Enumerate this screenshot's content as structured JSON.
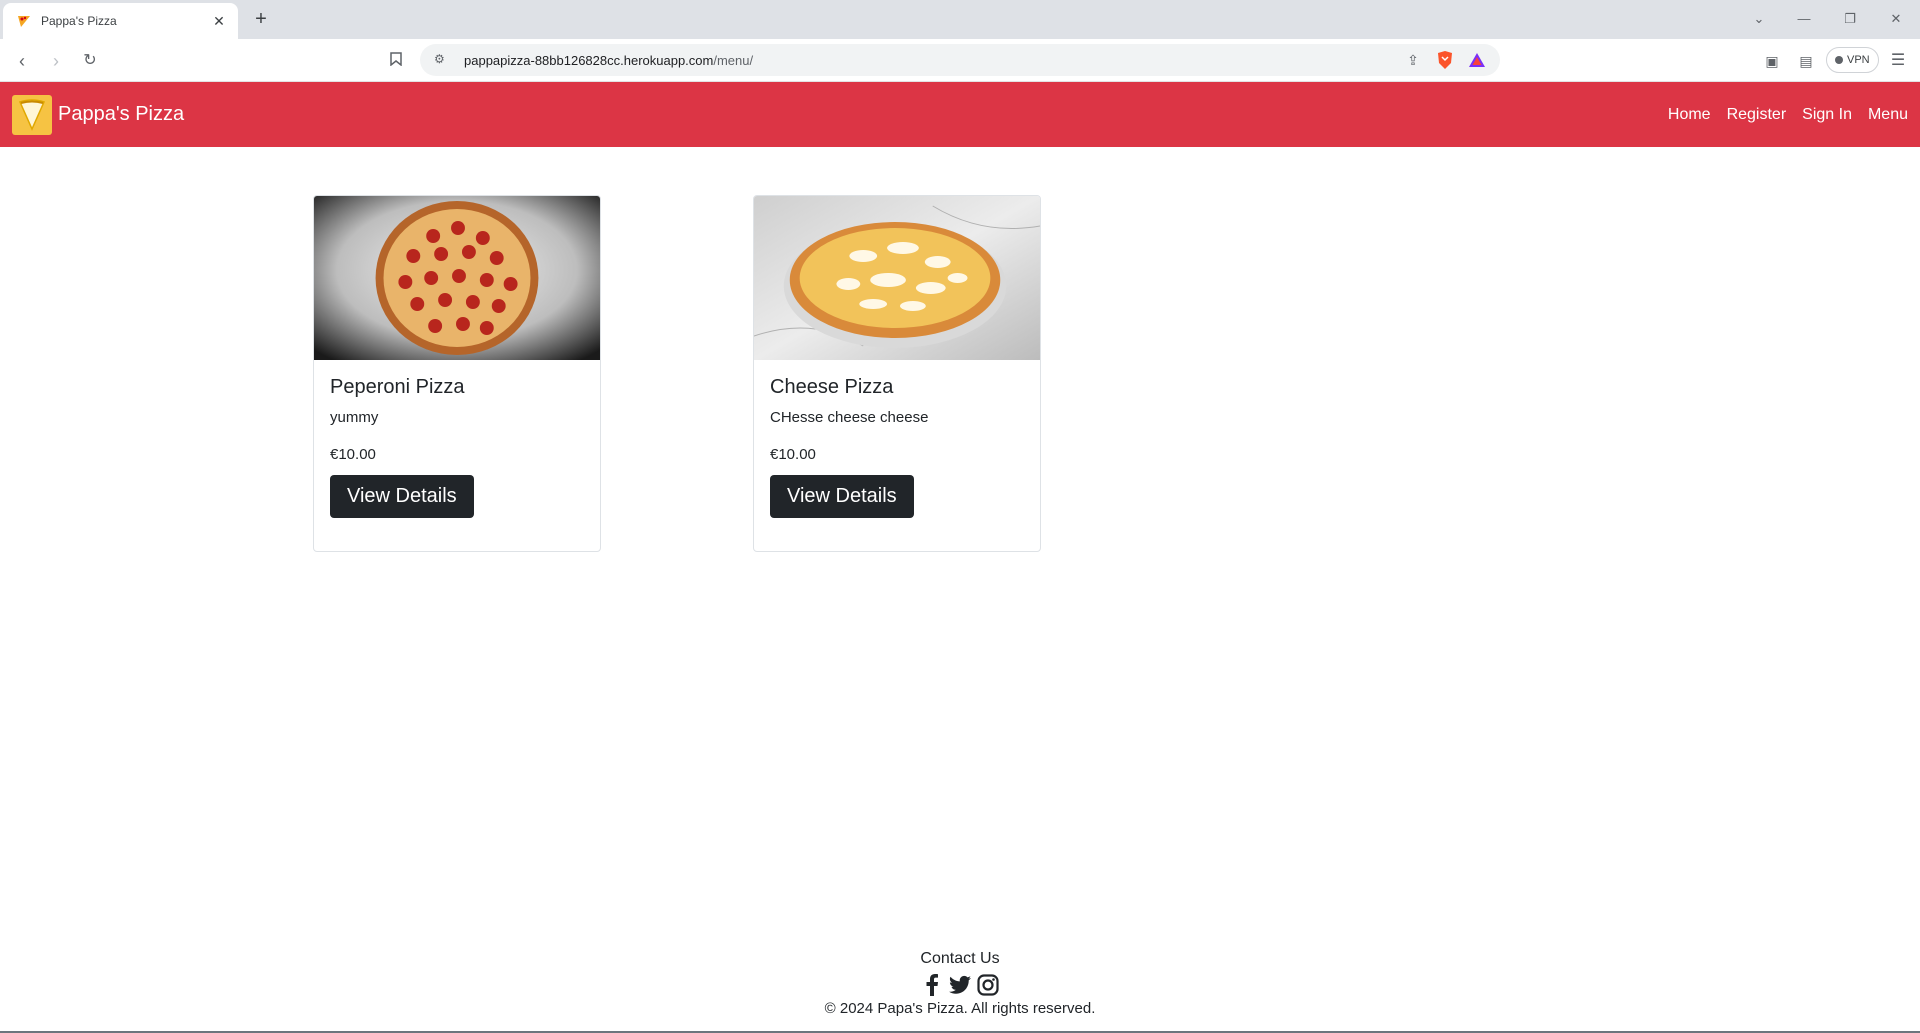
{
  "browser": {
    "tab_title": "Pappa's Pizza",
    "tab_close": "✕",
    "new_tab": "+",
    "url_host": "pappapizza-88bb126828cc.herokuapp.com",
    "url_path": "/menu/",
    "vpn_label": "VPN"
  },
  "navbar": {
    "brand": "Pappa's Pizza",
    "links": [
      "Home",
      "Register",
      "Sign In",
      "Menu"
    ],
    "accent_color": "#dc3545"
  },
  "menu": {
    "items": [
      {
        "name": "Peperoni Pizza",
        "description": "yummy",
        "price": "€10.00",
        "button": "View Details"
      },
      {
        "name": "Cheese Pizza",
        "description": "CHesse cheese cheese",
        "price": "€10.00",
        "button": "View Details"
      }
    ]
  },
  "footer": {
    "contact": "Contact Us",
    "social": [
      "facebook-icon",
      "twitter-icon",
      "instagram-icon"
    ],
    "copyright": "© 2024 Papa's Pizza. All rights reserved."
  }
}
